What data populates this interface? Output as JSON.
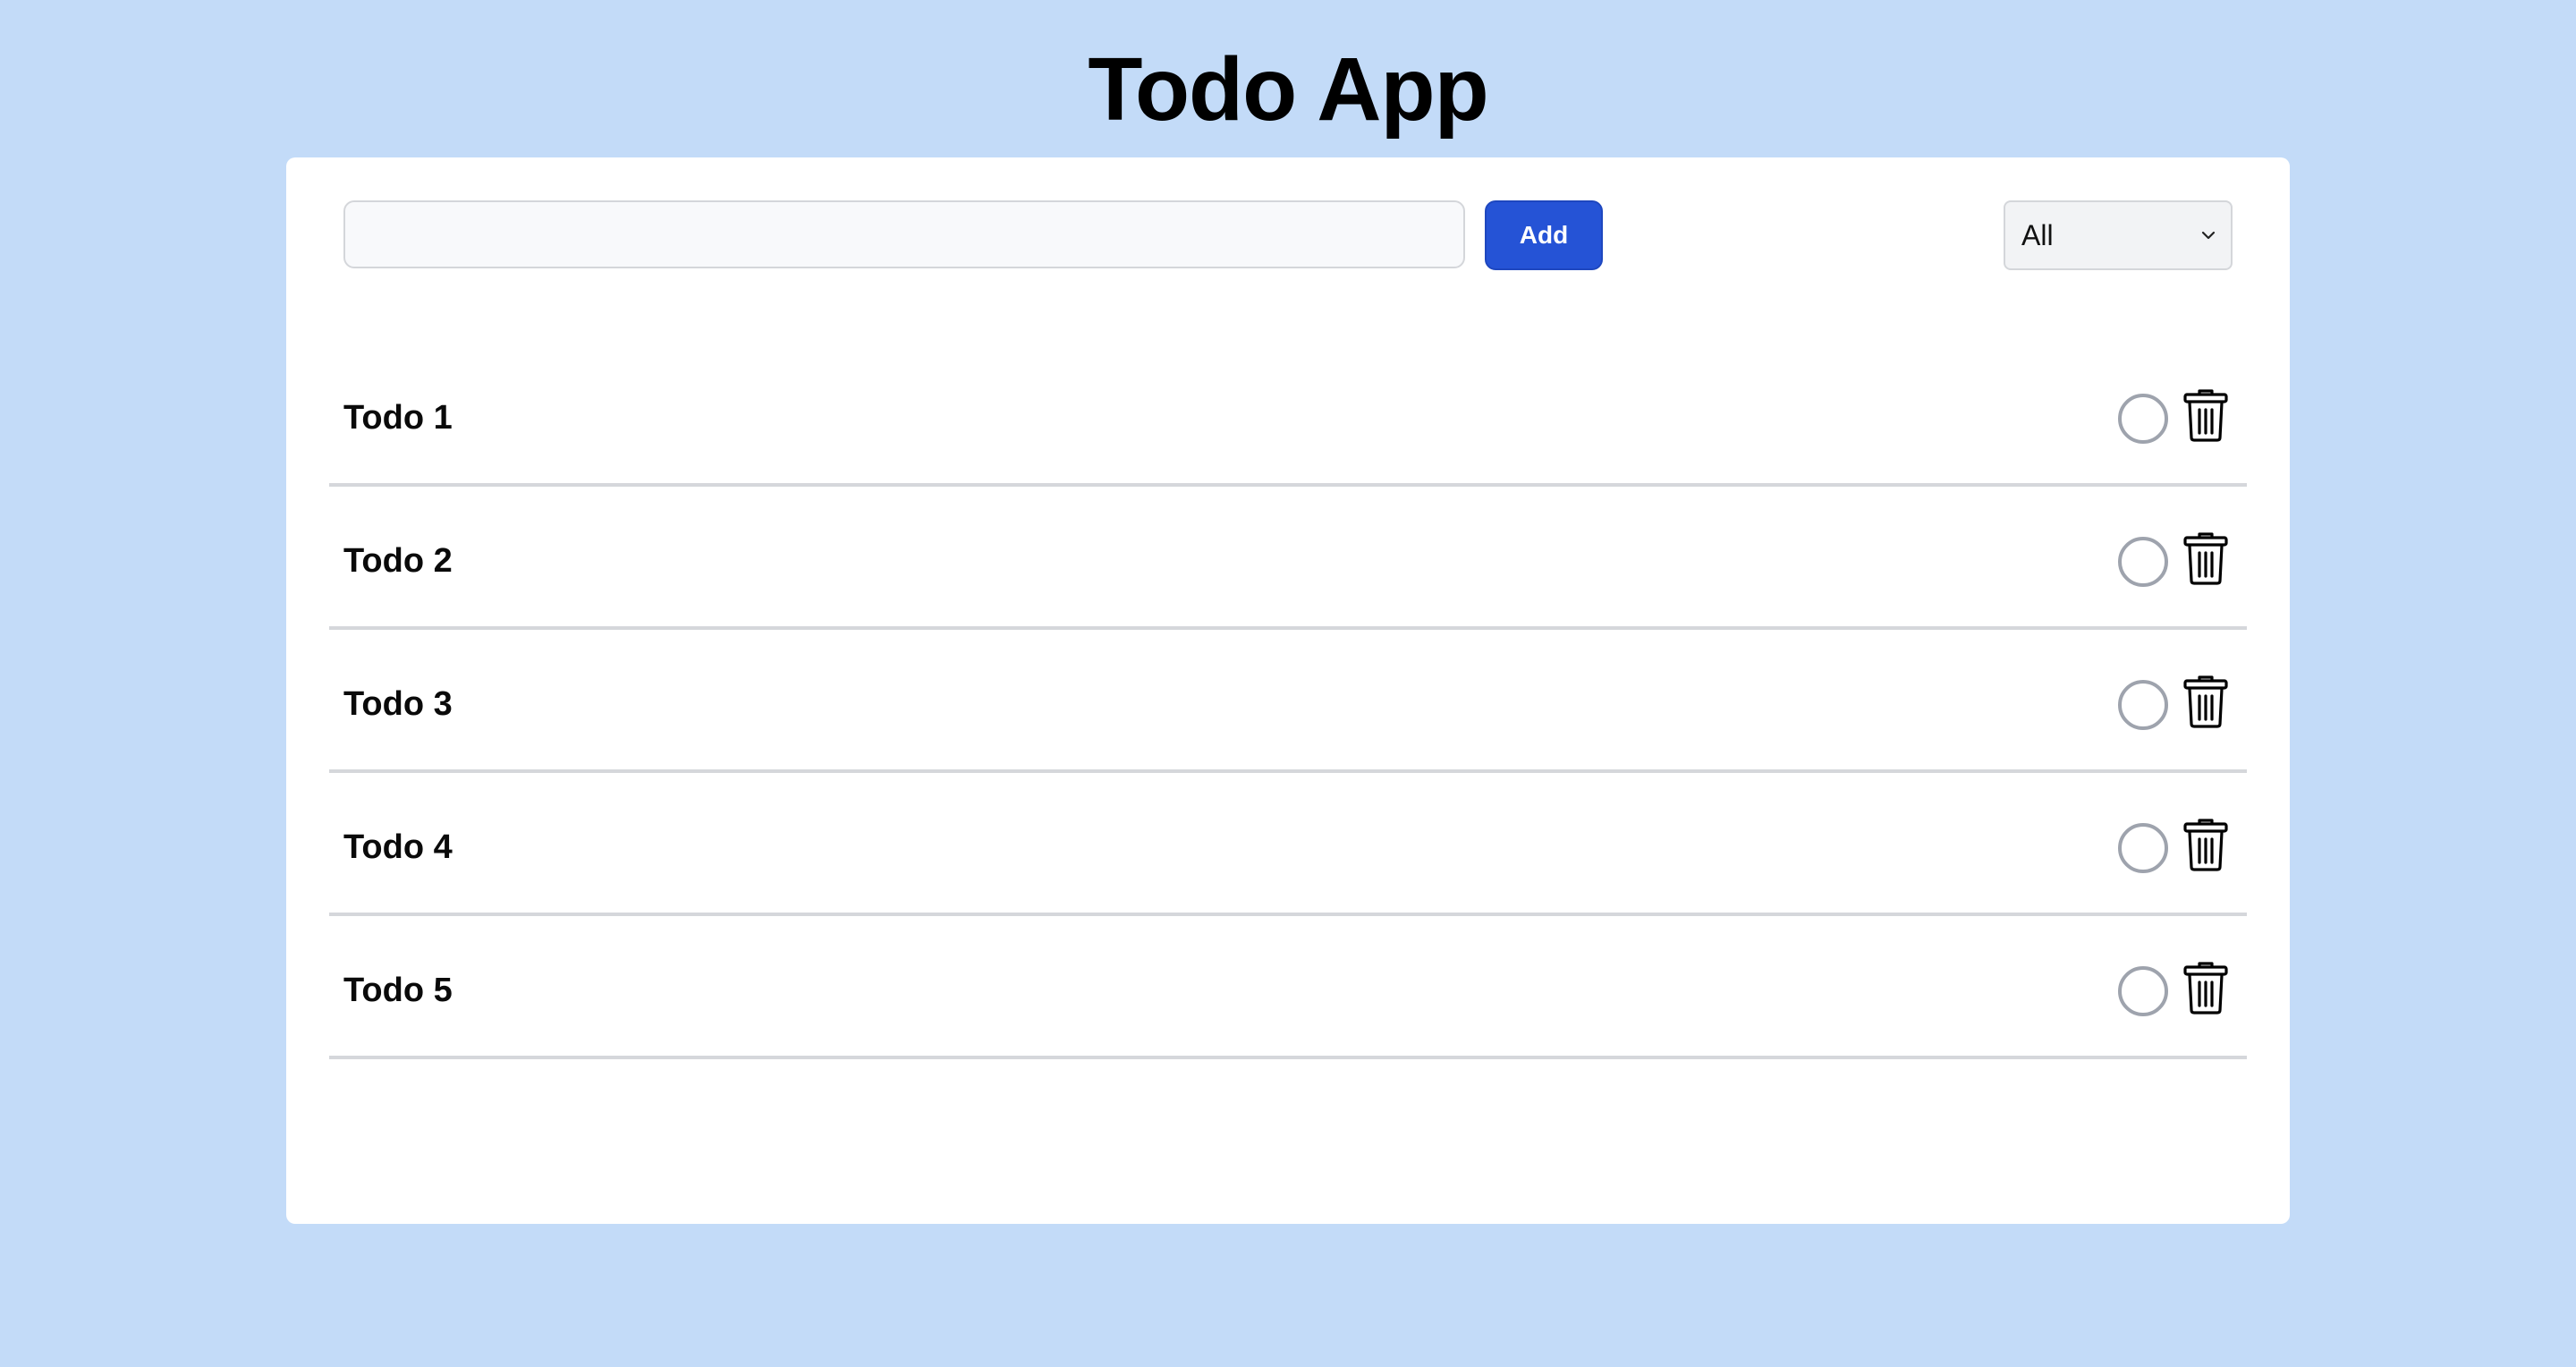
{
  "header": {
    "title": "Todo App"
  },
  "form": {
    "input_value": "",
    "input_placeholder": "",
    "add_label": "Add"
  },
  "filter": {
    "selected": "All"
  },
  "todos": [
    {
      "label": "Todo 1",
      "completed": false
    },
    {
      "label": "Todo 2",
      "completed": false
    },
    {
      "label": "Todo 3",
      "completed": false
    },
    {
      "label": "Todo 4",
      "completed": false
    },
    {
      "label": "Todo 5",
      "completed": false
    }
  ],
  "icons": {
    "toggle": "circle-outline-icon",
    "delete": "trash-icon"
  },
  "colors": {
    "background": "#c3dbf8",
    "card": "#ffffff",
    "accent": "#2553d6",
    "divider": "#d5d7db",
    "toggle_border": "#9ea3ad"
  }
}
